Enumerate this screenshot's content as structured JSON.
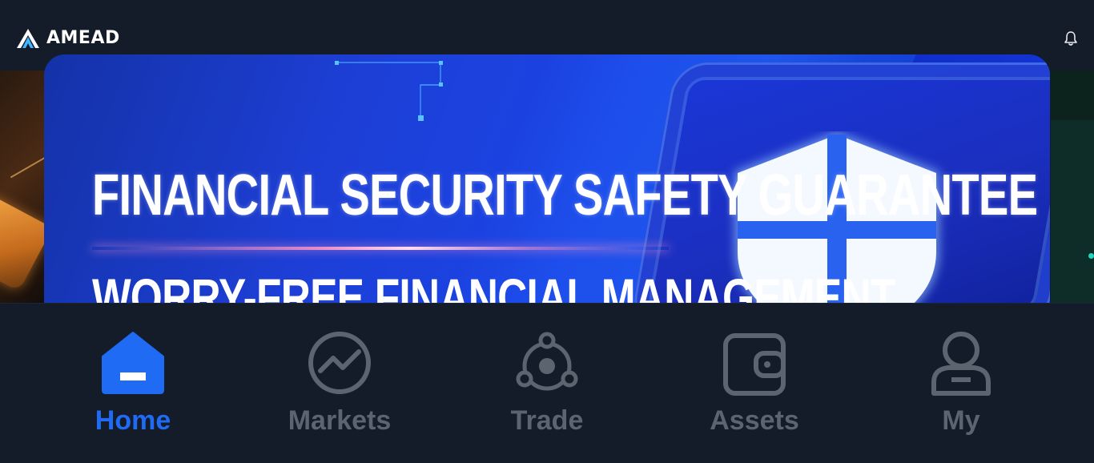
{
  "header": {
    "brand_name": "AMEAD",
    "logo_icon": "amead-logo-mark",
    "notification_icon": "bell-icon"
  },
  "banner": {
    "headline": "FINANCIAL SECURITY SAFETY GUARANTEE",
    "subline": "WORRY-FREE FINANCIAL MANAGEMENT",
    "shield_icon": "shield-icon",
    "accent_color": "#1d3fd6"
  },
  "tabbar": {
    "active_color": "#1f6bf4",
    "inactive_color": "#5c6470",
    "tabs": [
      {
        "label": "Home",
        "icon": "home-icon",
        "active": true
      },
      {
        "label": "Markets",
        "icon": "chart-line-icon",
        "active": false
      },
      {
        "label": "Trade",
        "icon": "trade-hub-icon",
        "active": false
      },
      {
        "label": "Assets",
        "icon": "wallet-icon",
        "active": false
      },
      {
        "label": "My",
        "icon": "user-icon",
        "active": false
      }
    ]
  }
}
